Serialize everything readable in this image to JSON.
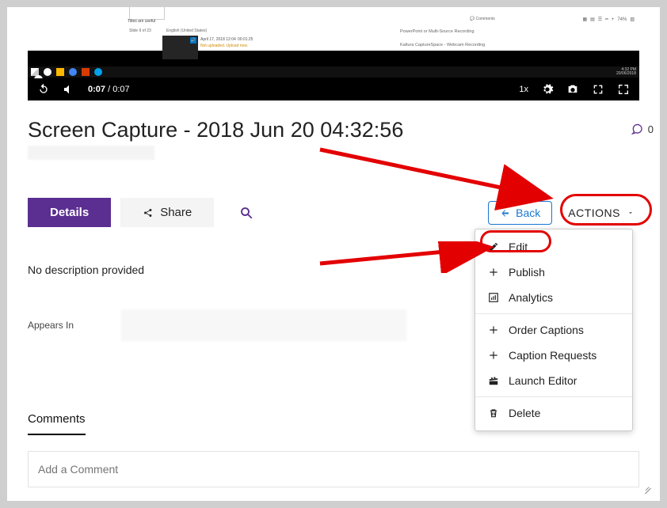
{
  "video": {
    "thumb_label": "Titles are useful",
    "slide_count": "Slide 9 of 23",
    "language": "English (United States)",
    "date": "April 17, 2018 12:04",
    "duration": "00:01:25",
    "upload_warn": "Not uploaded. Upload now.",
    "right1": "PowerPoint or Multi-Source Recording",
    "right2": "Kaltura CaptureSpace - Webcam Recording",
    "comments_small": "Comments",
    "zoom": "74%",
    "clock_time": "4:32 PM",
    "clock_date": "20/06/2018",
    "current_time": "0:07",
    "total_time": "0:07",
    "speed": "1x"
  },
  "page": {
    "title": "Screen Capture - 2018 Jun 20 04:32:56",
    "comment_count": "0",
    "tabs": {
      "details": "Details",
      "share": "Share"
    },
    "back": "Back",
    "actions": "ACTIONS",
    "description": "No description provided",
    "appears_in": "Appears In",
    "comments_heading": "Comments",
    "comment_placeholder": "Add a Comment"
  },
  "menu": {
    "edit": "Edit",
    "publish": "Publish",
    "analytics": "Analytics",
    "order_captions": "Order Captions",
    "caption_requests": "Caption Requests",
    "launch_editor": "Launch Editor",
    "delete": "Delete"
  }
}
